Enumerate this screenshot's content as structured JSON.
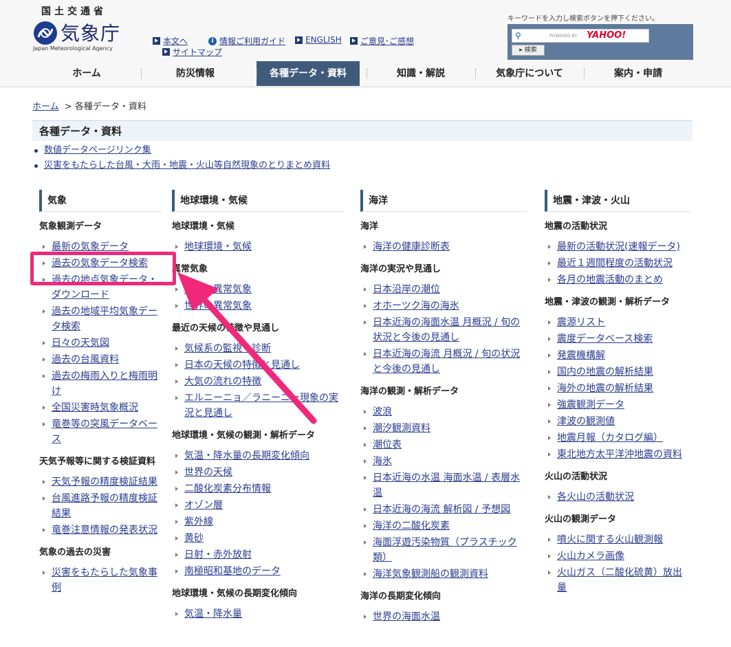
{
  "header": {
    "ministry": "国土交通省",
    "agency_name": "気象庁",
    "agency_en": "Japan Meteorological Agency",
    "util_links": [
      "本文へ",
      "情報ご利用ガイド",
      "ENGLISH",
      "ご意見･ご感想",
      "サイトマップ"
    ],
    "search_hint": "キーワードを入力し検索ボタンを押下ください。",
    "powered_by": "POWERED BY",
    "yahoo": "YAHOO!",
    "search_button": "検索"
  },
  "nav": {
    "items": [
      "ホーム",
      "防災情報",
      "各種データ・資料",
      "知識・解説",
      "気象庁について",
      "案内・申請"
    ],
    "active": "各種データ・資料"
  },
  "breadcrumb": {
    "home": "ホーム",
    "separator": ">",
    "current": "各種データ・資料"
  },
  "page_title": "各種データ・資料",
  "top_links": [
    "数値データページリンク集",
    "災害をもたらした台風・大雨・地震・火山等自然現象のとりまとめ資料"
  ],
  "columns": [
    {
      "title": "気象",
      "sections": [
        {
          "title": "気象観測データ",
          "items": [
            "最新の気象データ",
            "過去の気象データ検索",
            "過去の地点気象データ・ダウンロード",
            "過去の地域平均気象データ検索",
            "日々の天気図",
            "過去の台風資料",
            "過去の梅雨入りと梅雨明け",
            "全国災害時気象概況",
            "竜巻等の突風データベース"
          ]
        },
        {
          "title": "天気予報等に関する検証資料",
          "items": [
            "天気予報の精度検証結果",
            "台風進路予報の精度検証結果",
            "竜巻注意情報の発表状況"
          ]
        },
        {
          "title": "気象の過去の災害",
          "items": [
            "災害をもたらした気象事例"
          ]
        }
      ]
    },
    {
      "title": "地球環境・気候",
      "sections": [
        {
          "title": "地球環境・気候",
          "items": [
            "地球環境・気候"
          ]
        },
        {
          "title": "異常気象",
          "items": [
            "日本の異常気象",
            "世界の異常気象"
          ]
        },
        {
          "title": "最近の天候の特徴や見通し",
          "items": [
            "気候系の監視・診断",
            "日本の天候の特徴と見通し",
            "大気の流れの特徴",
            "エルニーニョ／ラニーニャ現象の実況と見通し"
          ]
        },
        {
          "title": "地球環境・気候の観測・解析データ",
          "items": [
            "気温・降水量の長期変化傾向",
            "世界の天候",
            "二酸化炭素分布情報",
            "オゾン層",
            "紫外線",
            "黄砂",
            "日射・赤外放射",
            "南極昭和基地のデータ"
          ]
        },
        {
          "title": "地球環境・気候の長期変化傾向",
          "items": [
            "気温・降水量"
          ]
        }
      ]
    },
    {
      "title": "海洋",
      "sections": [
        {
          "title": "海洋",
          "items": [
            "海洋の健康診断表"
          ]
        },
        {
          "title": "海洋の実況や見通し",
          "items": [
            "日本沿岸の潮位",
            "オホーツク海の海氷",
            "日本近海の海面水温 月概況 / 旬の状況と今後の見通し",
            "日本近海の海流 月概況 / 旬の状況と今後の見通し"
          ]
        },
        {
          "title": "海洋の観測・解析データ",
          "items": [
            "波浪",
            "潮汐観測資料",
            "潮位表",
            "海氷",
            "日本近海の水温 海面水温 / 表層水温",
            "日本近海の海流 解析図 / 予想図",
            "海洋の二酸化炭素",
            "海面浮遊汚染物質（プラスチック類）",
            "海洋気象観測船の観測資料"
          ]
        },
        {
          "title": "海洋の長期変化傾向",
          "items": [
            "世界の海面水温"
          ]
        }
      ]
    },
    {
      "title": "地震・津波・火山",
      "sections": [
        {
          "title": "地震の活動状況",
          "items": [
            "最新の活動状況(速報データ)",
            "最近１週間程度の活動状況",
            "各月の地震活動のまとめ"
          ]
        },
        {
          "title": "地震・津波の観測・解析データ",
          "items": [
            "震源リスト",
            "震度データベース検索",
            "発震機構解",
            "国内の地震の解析結果",
            "海外の地震の解析結果",
            "強震観測データ",
            "津波の観測値",
            "地震月報（カタログ編）",
            "東北地方太平洋沖地震の資料"
          ]
        },
        {
          "title": "火山の活動状況",
          "items": [
            "各火山の活動状況"
          ]
        },
        {
          "title": "火山の観測データ",
          "items": [
            "噴火に関する火山観測報",
            "火山カメラ画像",
            "火山ガス（二酸化硫黄）放出量"
          ]
        }
      ]
    }
  ],
  "colors": {
    "accent": "#3f5a7a",
    "link": "#2a3d8f",
    "highlight": "#f0287a"
  }
}
